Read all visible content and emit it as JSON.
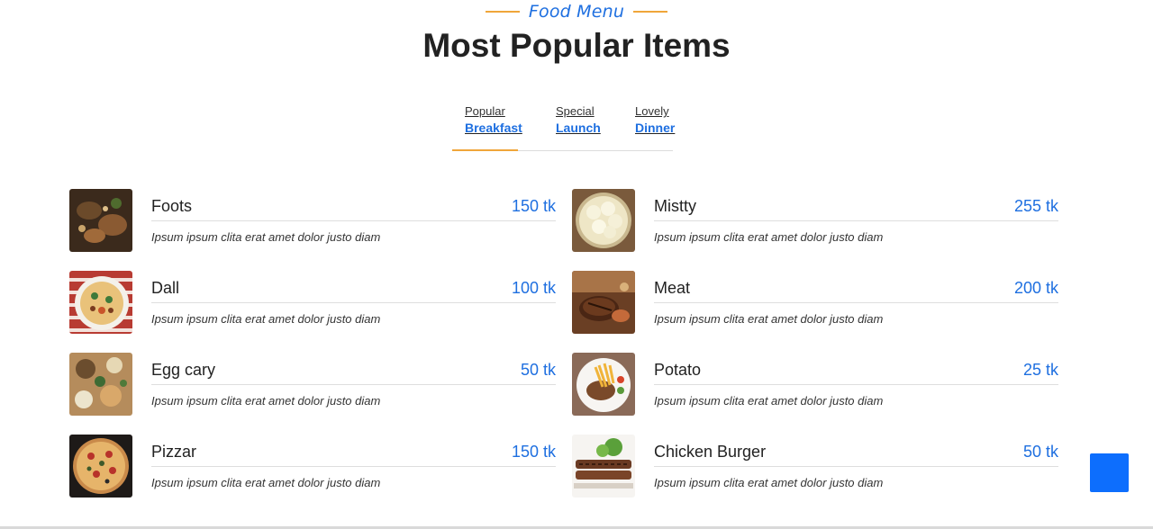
{
  "header": {
    "kicker": "Food Menu",
    "title": "Most Popular Items"
  },
  "tabs": [
    {
      "small": "Popular",
      "big": "Breakfast"
    },
    {
      "small": "Special",
      "big": "Launch"
    },
    {
      "small": "Lovely",
      "big": "Dinner"
    }
  ],
  "items": [
    {
      "name": "Foots",
      "price": "150 tk",
      "desc": "Ipsum ipsum clita erat amet dolor justo diam",
      "image": "roasted-food-platter"
    },
    {
      "name": "Mistty",
      "price": "255 tk",
      "desc": "Ipsum ipsum clita erat amet dolor justo diam",
      "image": "sweet-dumplings"
    },
    {
      "name": "Dall",
      "price": "100 tk",
      "desc": "Ipsum ipsum clita erat amet dolor justo diam",
      "image": "pizza-plate"
    },
    {
      "name": "Meat",
      "price": "200 tk",
      "desc": "Ipsum ipsum clita erat amet dolor justo diam",
      "image": "grilled-steak"
    },
    {
      "name": "Egg cary",
      "price": "50 tk",
      "desc": "Ipsum ipsum clita erat amet dolor justo diam",
      "image": "table-spread"
    },
    {
      "name": "Potato",
      "price": "25 tk",
      "desc": "Ipsum ipsum clita erat amet dolor justo diam",
      "image": "fries-plate"
    },
    {
      "name": "Pizzar",
      "price": "150 tk",
      "desc": "Ipsum ipsum clita erat amet dolor justo diam",
      "image": "pizza"
    },
    {
      "name": "Chicken Burger",
      "price": "50 tk",
      "desc": "Ipsum ipsum clita erat amet dolor justo diam",
      "image": "burger"
    }
  ],
  "colors": {
    "accent": "#1e6fe0",
    "highlight": "#f0a63a",
    "button": "#0d6efd"
  },
  "scroll_button": {
    "icon": "arrow-up-icon"
  }
}
